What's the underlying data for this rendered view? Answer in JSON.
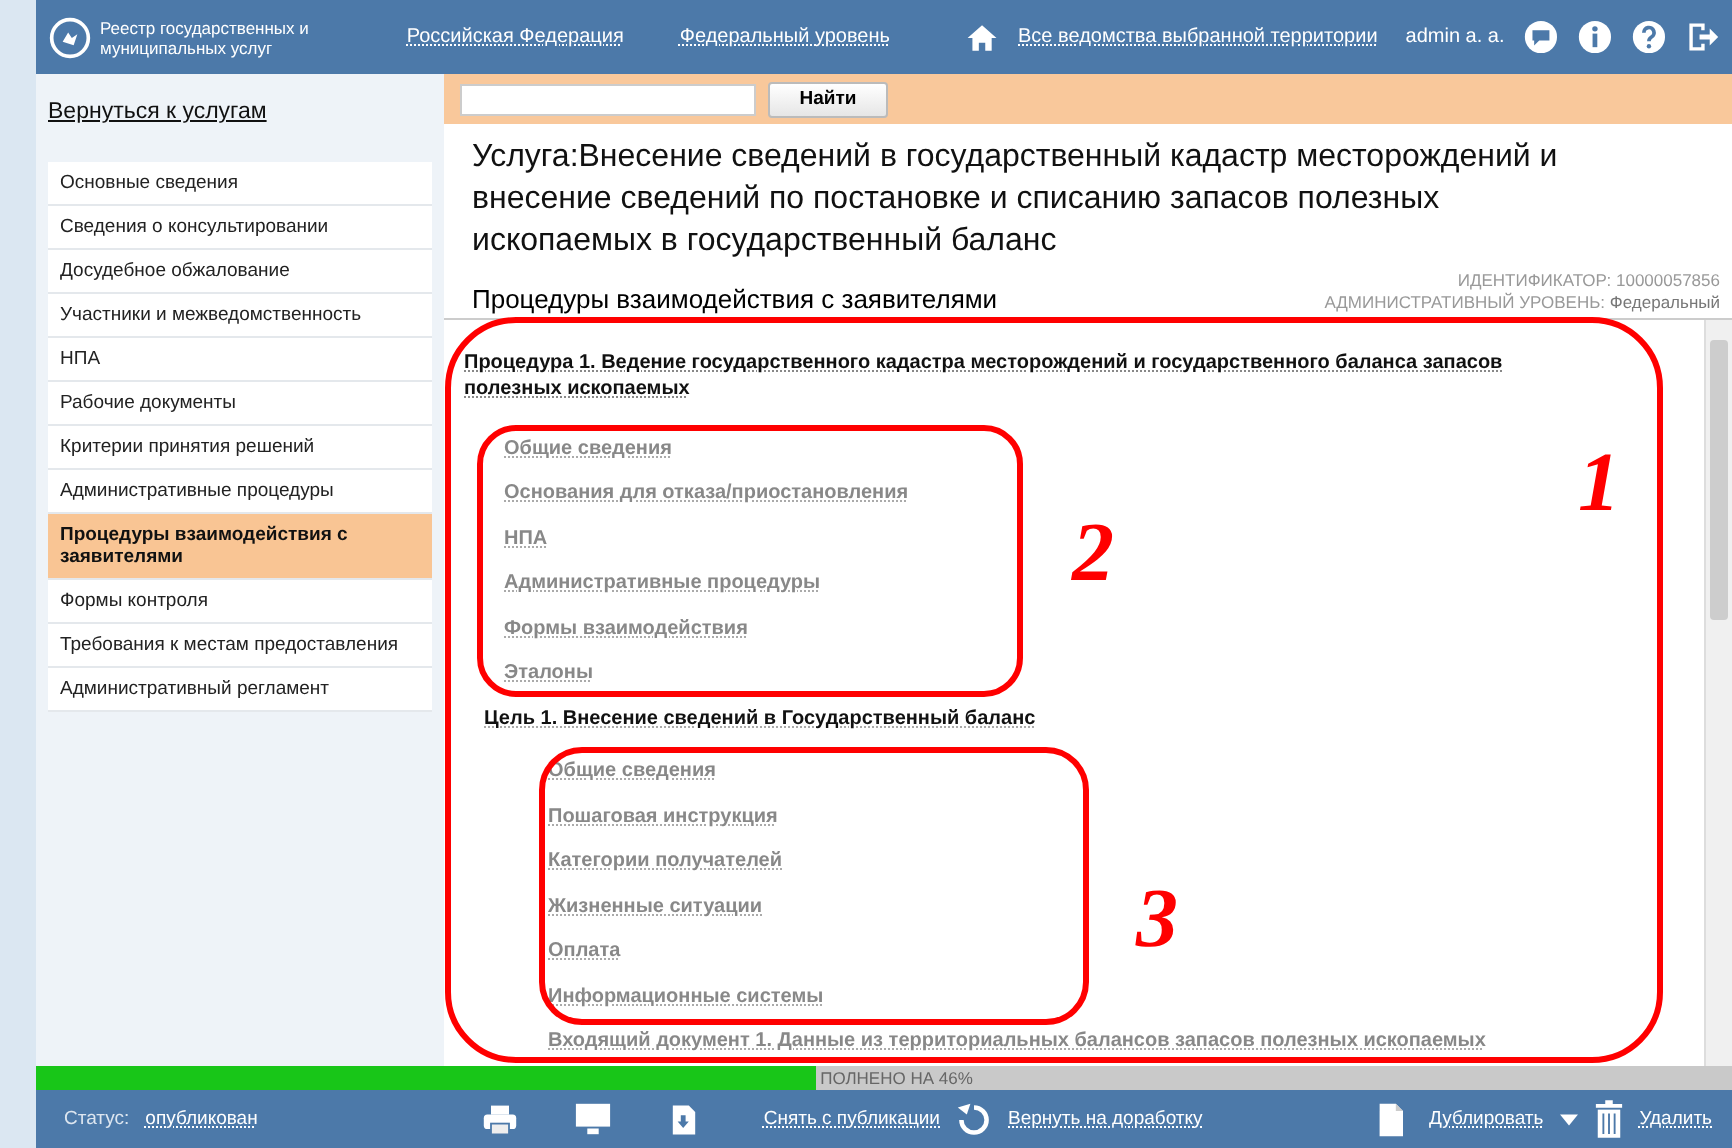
{
  "header": {
    "logo_text": "Реестр государственных и муниципальных услуг",
    "links": [
      "Российская Федерация",
      "Федеральный уровень"
    ],
    "territory_link": "Все ведомства выбранной территории",
    "user": "admin a. a."
  },
  "sidebar": {
    "back_link": "Вернуться к услугам",
    "items": [
      {
        "label": "Основные сведения",
        "selected": false
      },
      {
        "label": "Сведения о консультировании",
        "selected": false
      },
      {
        "label": "Досудебное обжалование",
        "selected": false
      },
      {
        "label": "Участники и межведомственность",
        "selected": false
      },
      {
        "label": "НПА",
        "selected": false
      },
      {
        "label": "Рабочие документы",
        "selected": false
      },
      {
        "label": "Критерии принятия решений",
        "selected": false
      },
      {
        "label": "Административные процедуры",
        "selected": false
      },
      {
        "label": "Процедуры взаимодействия с заявителями",
        "selected": true
      },
      {
        "label": "Формы контроля",
        "selected": false
      },
      {
        "label": "Требования к местам предоставления",
        "selected": false
      },
      {
        "label": "Административный регламент",
        "selected": false
      }
    ]
  },
  "search": {
    "button": "Найти"
  },
  "service_title": "Услуга:Внесение сведений в государственный кадастр месторождений и внесение сведений по постановке и списанию запасов полезных ископаемых в государственный баланс",
  "identifier": "ИДЕНТИФИКАТОР: 10000057856",
  "admin_level_label": "АДМИНИСТРАТИВНЫЙ УРОВЕНЬ:",
  "admin_level_value": "Федеральный",
  "section_title": "Процедуры взаимодействия с заявителями",
  "procedures": [
    {
      "title": "Процедура 1. Ведение государственного кадастра месторождений и государственного баланса запасов полезных ископаемых",
      "children": [
        {
          "label": "Общие сведения"
        },
        {
          "label": "Основания для отказа/приостановления"
        },
        {
          "label": "НПА"
        },
        {
          "label": "Административные процедуры"
        },
        {
          "label": "Формы взаимодействия"
        },
        {
          "label": "Эталоны"
        },
        {
          "label": "Цель 1. Внесение сведений в Государственный баланс",
          "children": [
            {
              "label": "Общие сведения"
            },
            {
              "label": "Пошаговая инструкция"
            },
            {
              "label": "Категории получателей"
            },
            {
              "label": "Жизненные ситуации"
            },
            {
              "label": "Оплата"
            },
            {
              "label": "Информационные системы"
            },
            {
              "label": "Входящий документ 1. Данные из территориальных балансов запасов полезных ископаемых"
            }
          ]
        }
      ]
    }
  ],
  "annotations": [
    "1",
    "2",
    "3"
  ],
  "progress": {
    "level": 0.46,
    "label": "ПОЛНЕНО НА 46%"
  },
  "footer": {
    "status_label": "Статус:",
    "status_value": "опубликован",
    "unpublish": "Снять с публикации",
    "return": "Вернуть на доработку",
    "duplicate": "Дублировать",
    "delete": "Удалить"
  }
}
